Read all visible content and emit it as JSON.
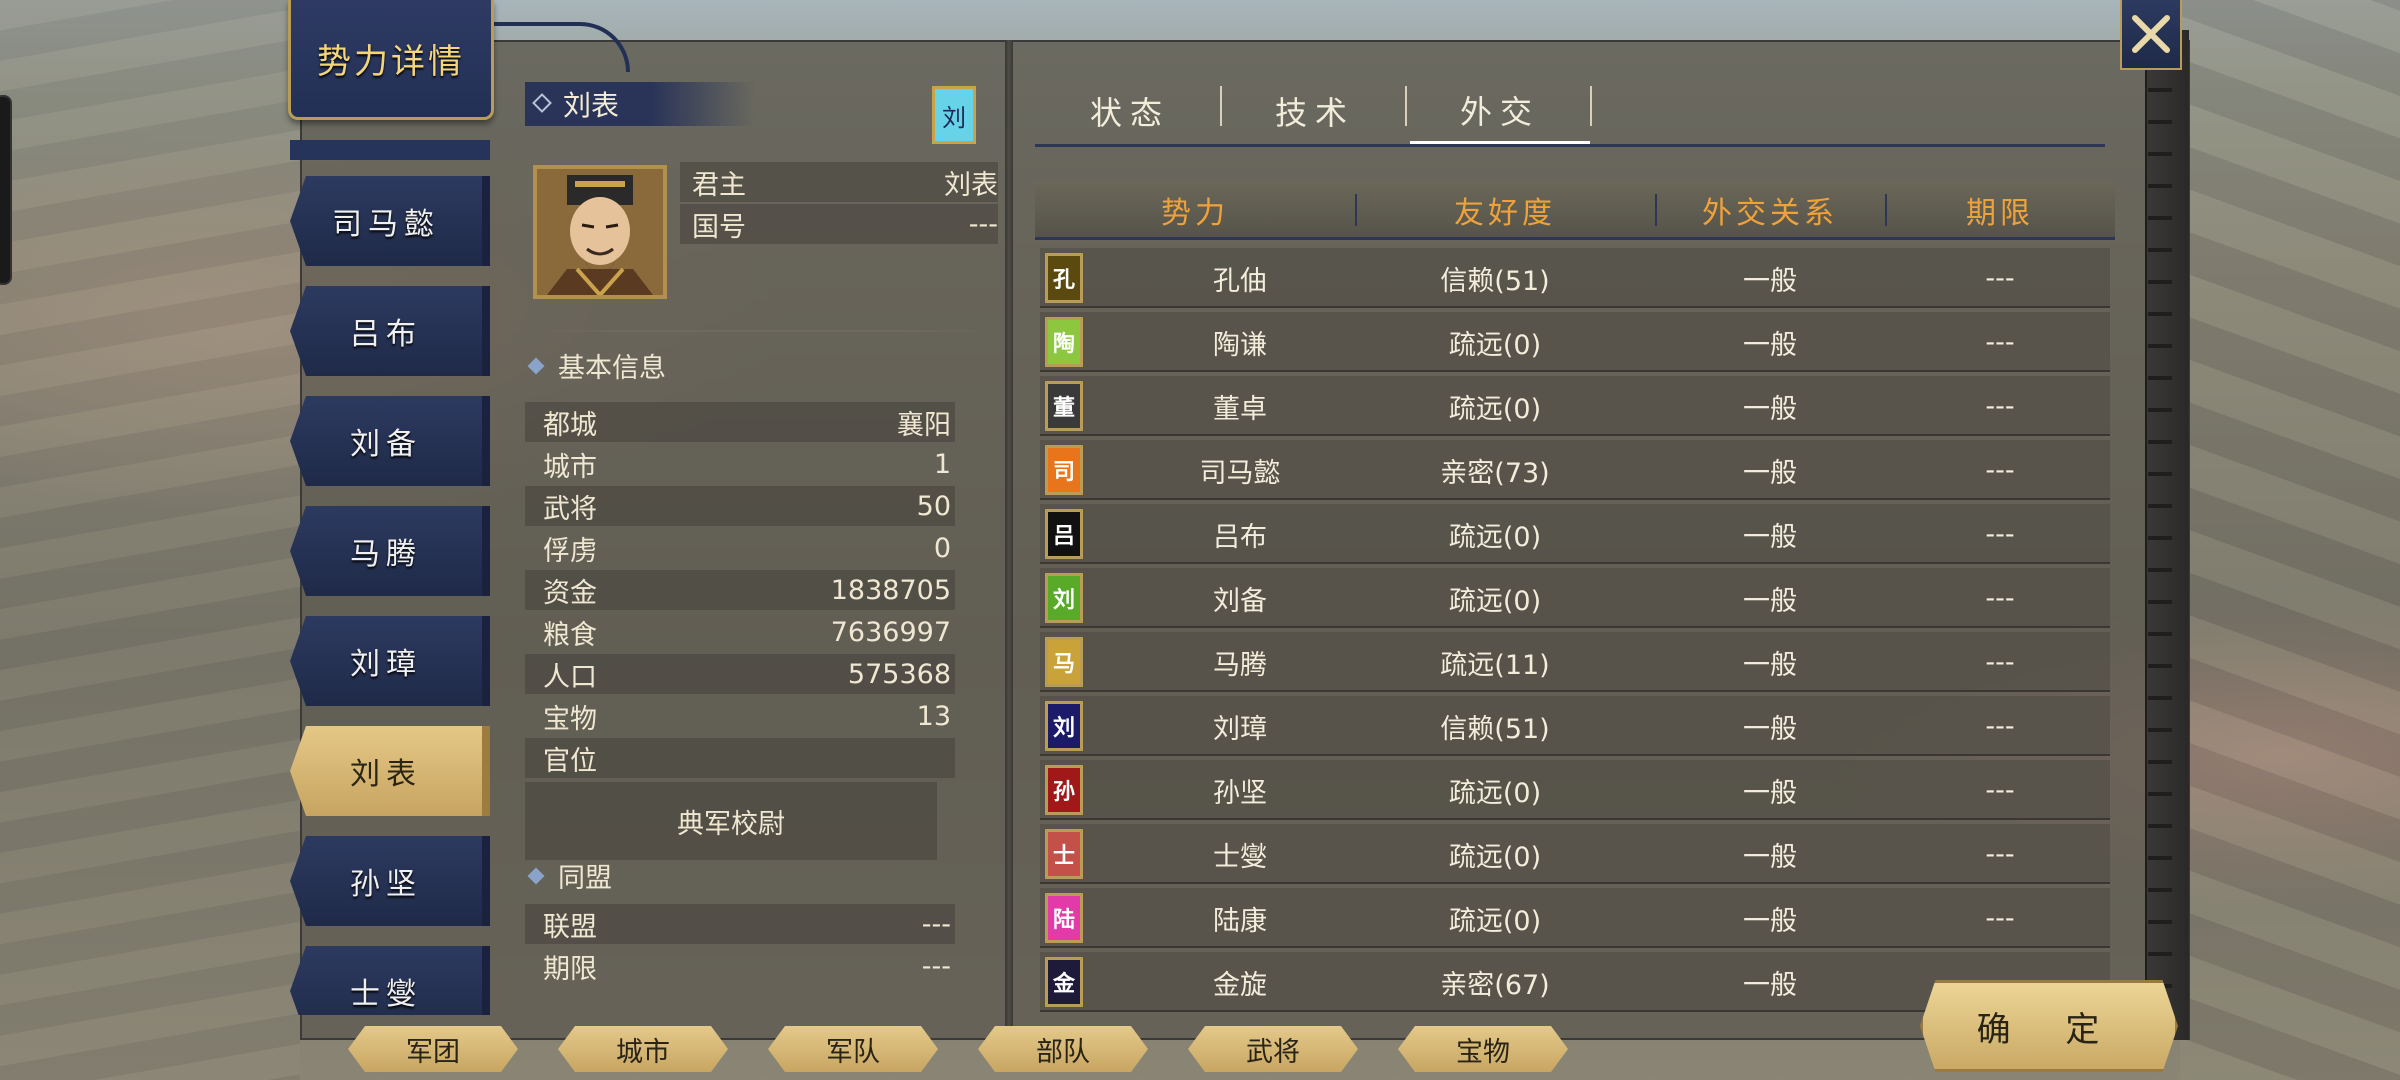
{
  "title": "势力详情",
  "factions_sidebar": [
    {
      "name": "司马懿",
      "active": false
    },
    {
      "name": "吕布",
      "active": false
    },
    {
      "name": "刘备",
      "active": false
    },
    {
      "name": "马腾",
      "active": false
    },
    {
      "name": "刘璋",
      "active": false
    },
    {
      "name": "刘表",
      "active": true
    },
    {
      "name": "孙坚",
      "active": false
    },
    {
      "name": "士燮",
      "active": false
    }
  ],
  "ruler": {
    "name": "刘表",
    "seal": "刘",
    "seal_color": "#66d3e8",
    "lord_label": "君主",
    "lord_value": "刘表",
    "title_label": "国号",
    "title_value": "---"
  },
  "basic_info": {
    "heading": "基本信息",
    "rows": [
      {
        "label": "都城",
        "value": "襄阳"
      },
      {
        "label": "城市",
        "value": "1"
      },
      {
        "label": "武将",
        "value": "50"
      },
      {
        "label": "俘虏",
        "value": "0"
      },
      {
        "label": "资金",
        "value": "1838705"
      },
      {
        "label": "粮食",
        "value": "7636997"
      },
      {
        "label": "人口",
        "value": "575368"
      },
      {
        "label": "宝物",
        "value": "13"
      },
      {
        "label": "官位",
        "value": ""
      }
    ],
    "office": "典军校尉"
  },
  "alliance": {
    "heading": "同盟",
    "rows": [
      {
        "label": "联盟",
        "value": "---"
      },
      {
        "label": "期限",
        "value": "---"
      }
    ]
  },
  "tabs": [
    {
      "label": "状态",
      "active": false
    },
    {
      "label": "技术",
      "active": false
    },
    {
      "label": "外交",
      "active": true
    }
  ],
  "diplomacy_table": {
    "headers": [
      "势力",
      "友好度",
      "外交关系",
      "期限"
    ],
    "rows": [
      {
        "flag": "孔",
        "flag_color": "#5a4a10",
        "name": "孔伷",
        "friendship": "信赖(51)",
        "relation": "一般",
        "term": "---"
      },
      {
        "flag": "陶",
        "flag_color": "#8dc63f",
        "name": "陶谦",
        "friendship": "疏远(0)",
        "relation": "一般",
        "term": "---"
      },
      {
        "flag": "董",
        "flag_color": "#3a3a3a",
        "name": "董卓",
        "friendship": "疏远(0)",
        "relation": "一般",
        "term": "---"
      },
      {
        "flag": "司",
        "flag_color": "#e8741c",
        "name": "司马懿",
        "friendship": "亲密(73)",
        "relation": "一般",
        "term": "---"
      },
      {
        "flag": "吕",
        "flag_color": "#111111",
        "name": "吕布",
        "friendship": "疏远(0)",
        "relation": "一般",
        "term": "---"
      },
      {
        "flag": "刘",
        "flag_color": "#5aaa2a",
        "name": "刘备",
        "friendship": "疏远(0)",
        "relation": "一般",
        "term": "---"
      },
      {
        "flag": "马",
        "flag_color": "#c9a23a",
        "name": "马腾",
        "friendship": "疏远(11)",
        "relation": "一般",
        "term": "---"
      },
      {
        "flag": "刘",
        "flag_color": "#1b1b6a",
        "name": "刘璋",
        "friendship": "信赖(51)",
        "relation": "一般",
        "term": "---"
      },
      {
        "flag": "孙",
        "flag_color": "#a01818",
        "name": "孙坚",
        "friendship": "疏远(0)",
        "relation": "一般",
        "term": "---"
      },
      {
        "flag": "士",
        "flag_color": "#c4504a",
        "name": "士燮",
        "friendship": "疏远(0)",
        "relation": "一般",
        "term": "---"
      },
      {
        "flag": "陆",
        "flag_color": "#e23aa8",
        "name": "陆康",
        "friendship": "疏远(0)",
        "relation": "一般",
        "term": "---"
      },
      {
        "flag": "金",
        "flag_color": "#1e1a3a",
        "name": "金旋",
        "friendship": "亲密(67)",
        "relation": "一般",
        "term": "---"
      }
    ]
  },
  "bottom_nav": [
    "军团",
    "城市",
    "军队",
    "部队",
    "武将",
    "宝物"
  ],
  "confirm_label": "确 定"
}
